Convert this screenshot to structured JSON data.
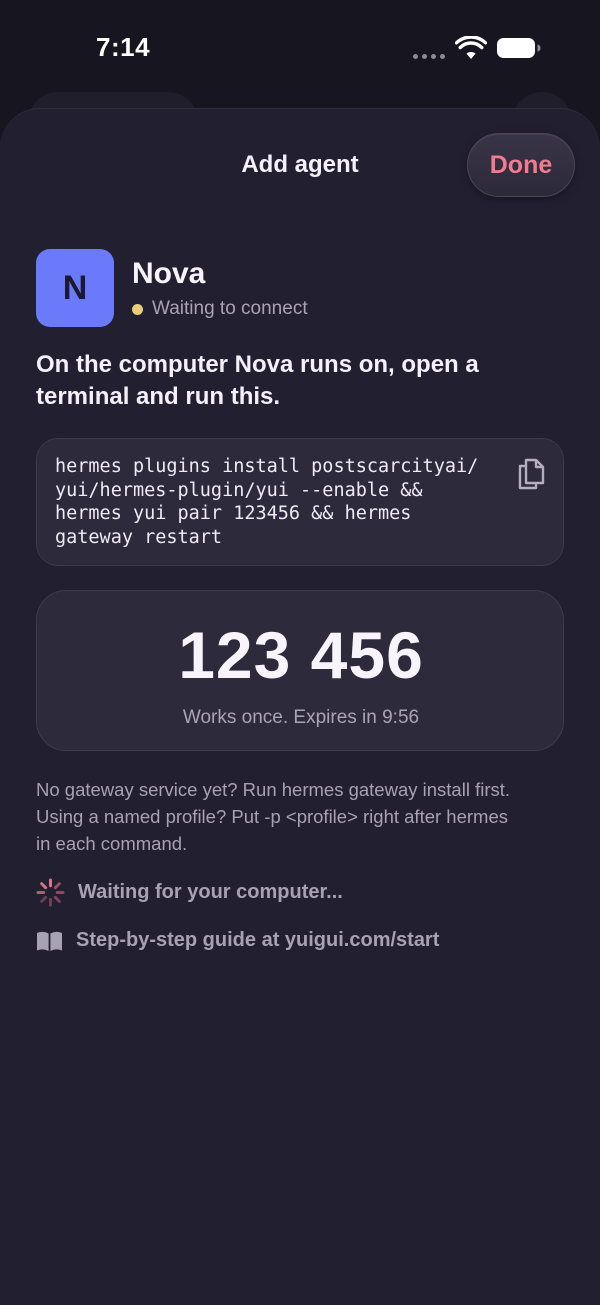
{
  "status_bar": {
    "time": "7:14"
  },
  "sheet": {
    "title": "Add agent",
    "done_label": "Done"
  },
  "agent": {
    "initial": "N",
    "name": "Nova",
    "status": "Waiting to connect",
    "avatar_color": "#6b7afb",
    "status_color": "#e8cd7a"
  },
  "instruction": "On the computer Nova runs on, open a terminal and run this.",
  "command": {
    "lines": [
      "hermes plugins install postscarcityai/",
      "yui/hermes-plugin/yui --enable &&",
      "hermes yui pair 123456 && hermes",
      "gateway restart"
    ],
    "copy_icon": "copy-icon"
  },
  "pairing": {
    "code": "123 456",
    "expiry": "Works once. Expires in 9:56"
  },
  "help": {
    "lines": [
      "No gateway service yet? Run hermes gateway install first.",
      "Using a named profile? Put -p <profile> right after hermes",
      "in each command."
    ]
  },
  "waiting": {
    "label": "Waiting for your computer...",
    "icon": "spinner-icon"
  },
  "guide": {
    "label": "Step-by-step guide at yuigui.com/start",
    "icon": "book-icon"
  },
  "colors": {
    "accent": "#f07c8d",
    "background": "#221f30"
  }
}
